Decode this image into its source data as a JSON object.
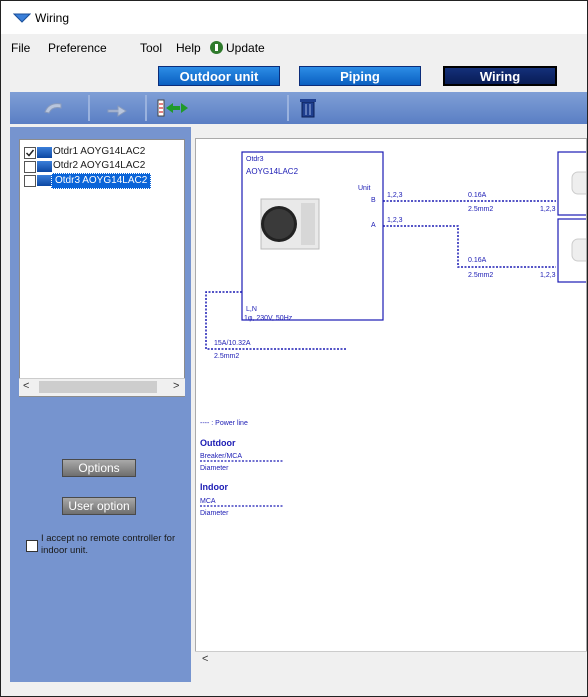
{
  "window": {
    "title": "Wiring"
  },
  "menu": {
    "file": "File",
    "preference": "Preference",
    "tool": "Tool",
    "help": "Help",
    "update": "Update"
  },
  "tabs": {
    "outdoor": "Outdoor unit",
    "piping": "Piping",
    "wiring": "Wiring"
  },
  "tree": {
    "items": [
      {
        "label": "Otdr1 AOYG14LAC2",
        "checked": true,
        "selected": false
      },
      {
        "label": "Otdr2 AOYG14LAC2",
        "checked": false,
        "selected": false
      },
      {
        "label": "Otdr3 AOYG14LAC2",
        "checked": false,
        "selected": true
      }
    ]
  },
  "scroll": {
    "left_arrow": "<",
    "right_arrow": ">"
  },
  "buttons": {
    "options": "Options",
    "user_option": "User option"
  },
  "accept": {
    "text": "I accept no remote controller for indoor unit."
  },
  "diagram": {
    "unit_name": "Otdr3",
    "unit_model": "AOYG14LAC2",
    "unit_label": "Unit",
    "terminal_b": "B",
    "terminal_a": "A",
    "wire_b_terminals": "1,2,3",
    "wire_a_terminals": "1,2,3",
    "wire_b_current": "0.16A",
    "wire_b_size": "2.5mm2",
    "wire_b_end": "1,2,3",
    "wire_a_current": "0.16A",
    "wire_a_size": "2.5mm2",
    "wire_a_end": "1,2,3",
    "power_terms": "L,N",
    "power_spec": "1φ, 230V, 50Hz",
    "breaker": "15A/10.32A",
    "power_size": "2.5mm2",
    "legend": {
      "power_line": "---- : Power line",
      "outdoor_title": "Outdoor",
      "outdoor_breaker": "Breaker/MCA",
      "outdoor_diameter": "Diameter",
      "indoor_title": "Indoor",
      "indoor_mca": "MCA",
      "indoor_diameter": "Diameter"
    },
    "bottom_left_arrow": "<"
  },
  "colors": {
    "unit_border": "#1b1bb4",
    "wire": "#1b1bb4",
    "tab_blue": "#0a5fc0",
    "panel": "#7694cf"
  },
  "icons": {
    "app": "wiring-app-icon",
    "update": "update-icon",
    "undo": "undo-icon",
    "redo": "redo-icon",
    "connect": "connect-icon",
    "delete": "trash-icon"
  }
}
